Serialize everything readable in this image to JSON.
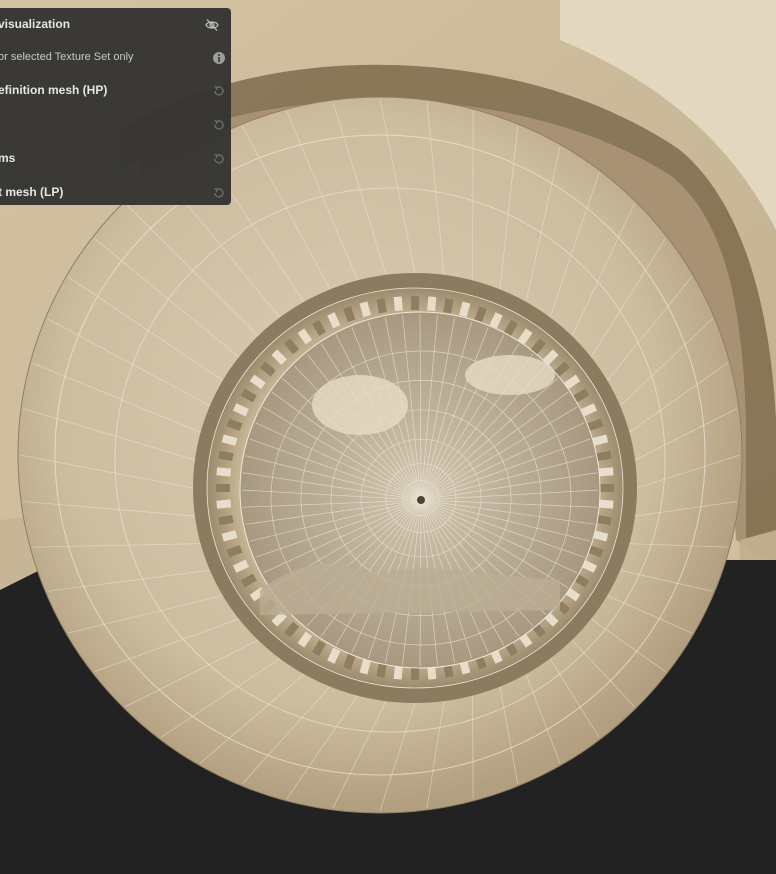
{
  "panel": {
    "rows": [
      {
        "label": "visualization",
        "icon": "eye-hidden-icon"
      },
      {
        "label": "or selected Texture Set only",
        "icon": "info-icon"
      },
      {
        "label": "efinition mesh (HP)",
        "icon": "reset-icon"
      },
      {
        "label": "",
        "icon": "reset-icon"
      },
      {
        "label": "ms",
        "icon": "reset-icon"
      },
      {
        "label": "t mesh (LP)",
        "icon": "reset-icon"
      }
    ]
  },
  "colors": {
    "background": "#222222",
    "mesh_base": "#c9b89a",
    "wireframe": "#ece6da",
    "panel_bg": "#343331",
    "panel_text": "#e6e6e6"
  }
}
